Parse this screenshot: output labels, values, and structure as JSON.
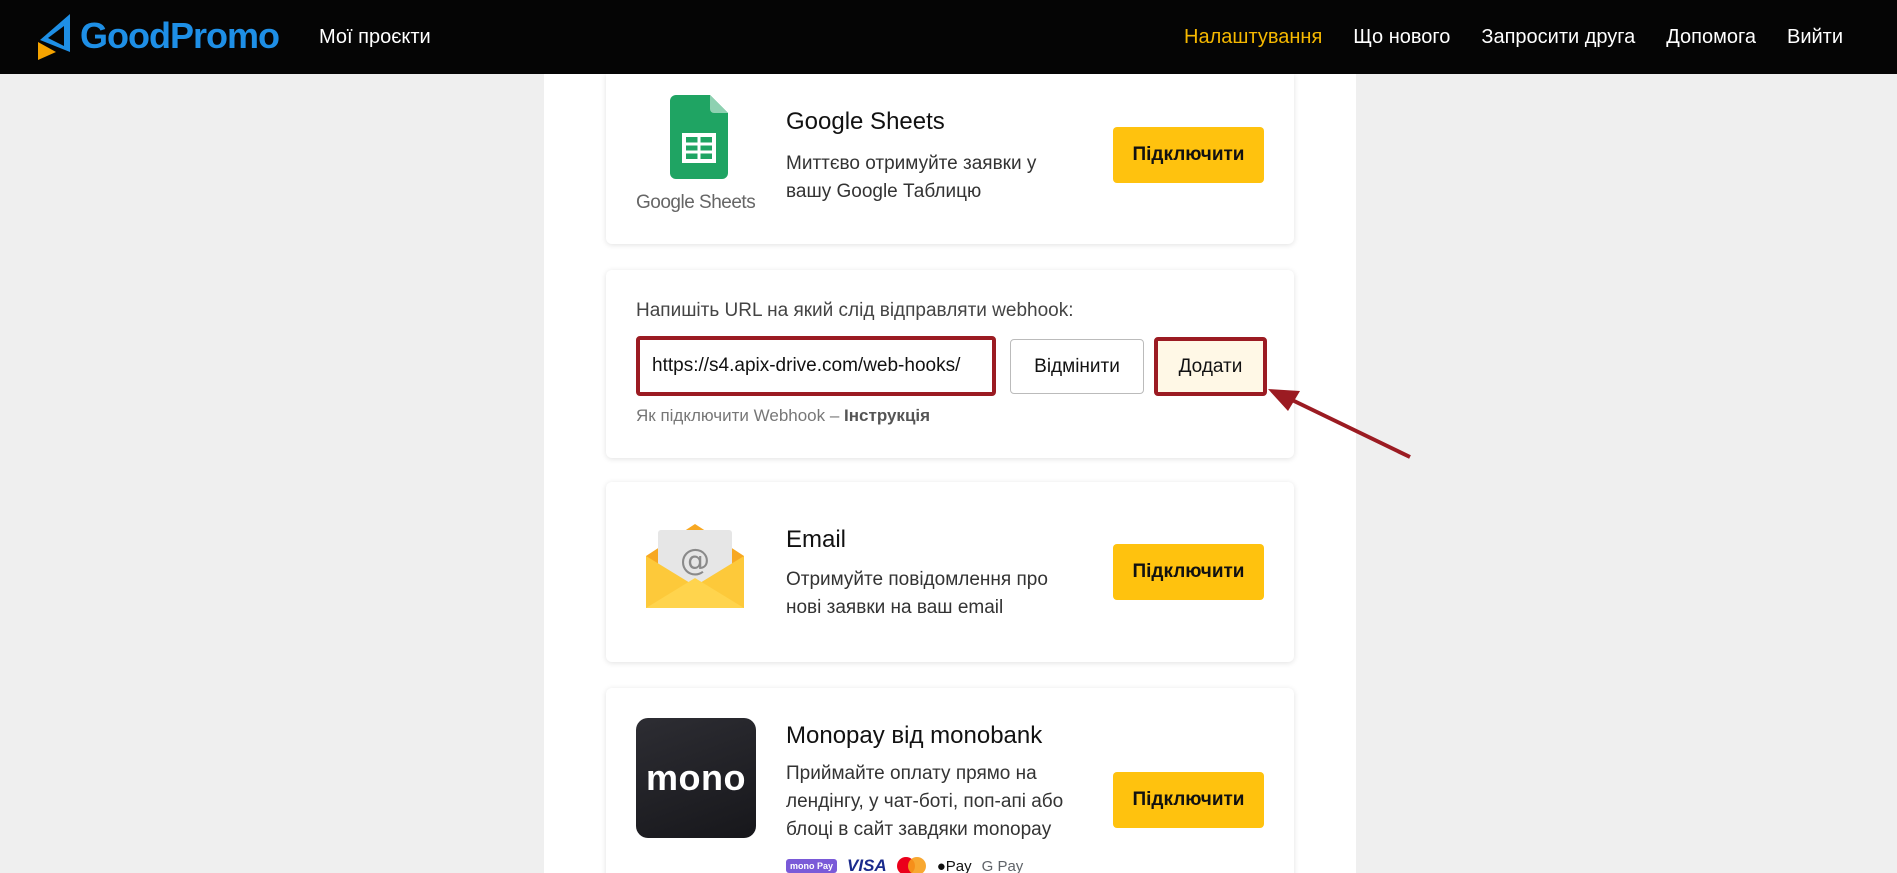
{
  "header": {
    "brand": "GoodPromo",
    "my_projects": "Мої проєкти",
    "nav": [
      {
        "label": "Налаштування",
        "active": true
      },
      {
        "label": "Що нового",
        "active": false
      },
      {
        "label": "Запросити друга",
        "active": false
      },
      {
        "label": "Допомога",
        "active": false
      },
      {
        "label": "Вийти",
        "active": false
      }
    ]
  },
  "cards": {
    "sheets": {
      "title": "Google Sheets",
      "description": "Миттєво отримуйте заявки у вашу Google Таблицю",
      "logo_caption": "Google Sheets",
      "button": "Підключити"
    },
    "webhook": {
      "label": "Напишіть URL на який слід відправляти webhook:",
      "url_value": "https://s4.apix-drive.com/web-hooks/",
      "cancel": "Відмінити",
      "add": "Додати",
      "help_prefix": "Як підключити Webhook – ",
      "help_link": "Інструкція"
    },
    "email": {
      "title": "Email",
      "description": "Отримуйте повідомлення про нові заявки на ваш email",
      "button": "Підключити"
    },
    "mono": {
      "title": "Monopay від monobank",
      "description": "Приймайте оплату прямо на лендінгу, у чат-боті, поп-апі або блоці в сайт завдяки monopay",
      "logo_text": "mono",
      "button": "Підключити",
      "payments": [
        "mono Pay",
        "VISA",
        "Pay",
        "G Pay"
      ]
    }
  },
  "colors": {
    "accent": "#ffc20e",
    "highlight": "#9b1b22",
    "brand_blue": "#1e8fe6",
    "nav_active": "#f5b800"
  }
}
